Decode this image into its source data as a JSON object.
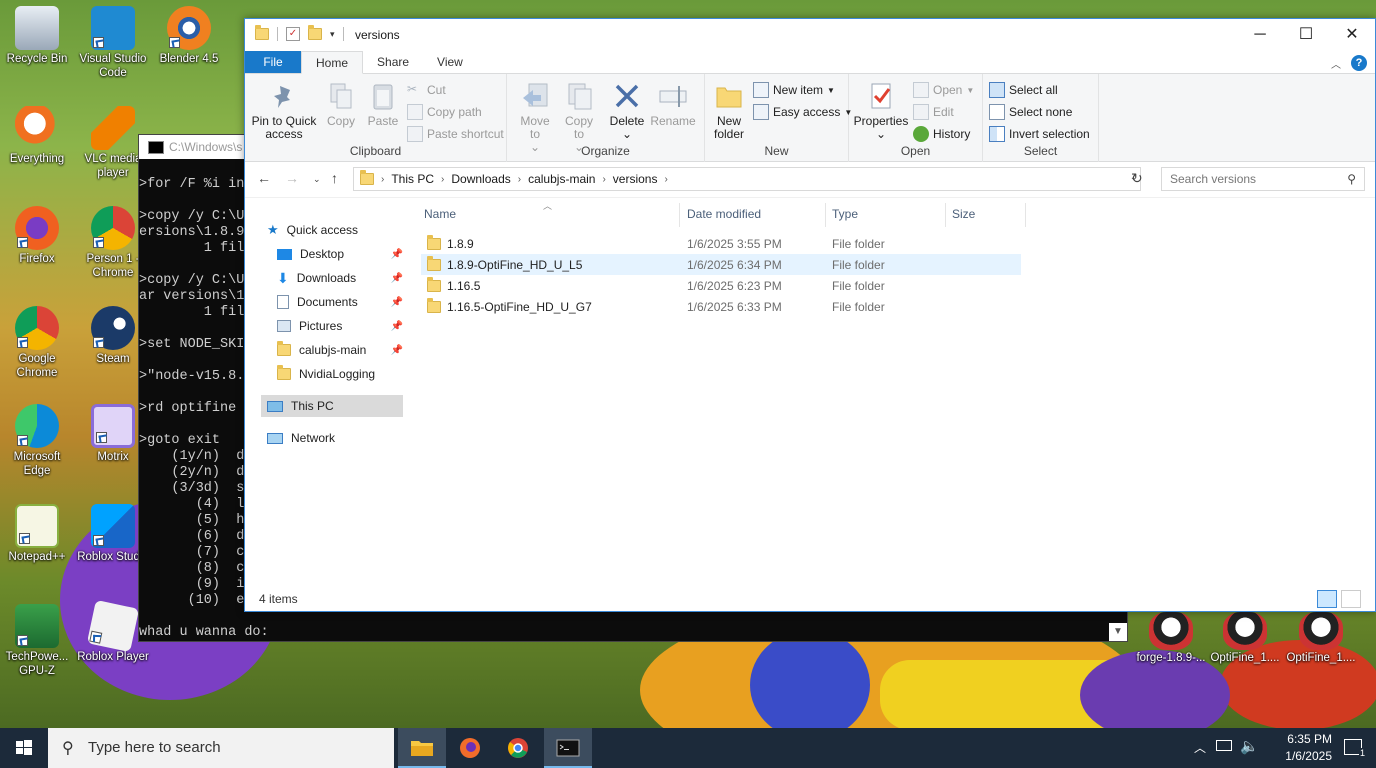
{
  "desktop": {
    "icons_left": [
      {
        "label": "Recycle Bin",
        "name": "recycle-bin-icon"
      },
      {
        "label": "Visual Studio Code",
        "name": "vscode-icon"
      },
      {
        "label": "Blender 4.5",
        "name": "blender-icon"
      },
      {
        "label": "Everything",
        "name": "everything-icon"
      },
      {
        "label": "VLC media player",
        "name": "vlc-icon"
      },
      {
        "label": "Firefox",
        "name": "firefox-icon"
      },
      {
        "label": "Person 1 - Chrome",
        "name": "chrome-person-icon"
      },
      {
        "label": "Google Chrome",
        "name": "chrome-icon"
      },
      {
        "label": "Steam",
        "name": "steam-icon"
      },
      {
        "label": "Microsoft Edge",
        "name": "edge-icon"
      },
      {
        "label": "Motrix",
        "name": "motrix-icon"
      },
      {
        "label": "Notepad++",
        "name": "notepadpp-icon"
      },
      {
        "label": "Roblox Studio",
        "name": "roblox-studio-icon"
      },
      {
        "label": "TechPowe... GPU-Z",
        "name": "gpuz-icon"
      },
      {
        "label": "Roblox Player",
        "name": "roblox-player-icon"
      }
    ],
    "icons_right": [
      {
        "label": "forge-1.8.9-...",
        "name": "java-jar-icon"
      },
      {
        "label": "OptiFine_1....",
        "name": "java-jar-icon"
      },
      {
        "label": "OptiFine_1....",
        "name": "java-jar-icon"
      }
    ]
  },
  "console": {
    "title": "C:\\Windows\\s",
    "lines": [
      "",
      ">for /F %i in",
      "",
      ">copy /y C:\\U",
      "ersions\\1.8.9",
      "        1 fil",
      "",
      ">copy /y C:\\U",
      "ar versions\\1",
      "        1 fil",
      "",
      ">set NODE_SKI",
      "",
      ">\"node-v15.8.",
      "",
      ">rd optifine",
      "",
      ">goto exit",
      "    (1y/n)  d",
      "    (2y/n)  d",
      "    (3/3d)  s",
      "       (4)  l",
      "       (5)  h",
      "       (6)  d",
      "       (7)  c",
      "       (8)  c",
      "       (9)  i",
      "      (10)  e",
      "",
      "whad u wanna do:"
    ]
  },
  "explorer": {
    "title": "versions",
    "window_buttons": {
      "minimize": "─",
      "maximize": "☐",
      "close": "✕"
    },
    "tabs": {
      "file": "File",
      "home": "Home",
      "share": "Share",
      "view": "View"
    },
    "ribbon": {
      "clipboard": {
        "group": "Clipboard",
        "pin": "Pin to Quick access",
        "copy": "Copy",
        "paste": "Paste",
        "cut": "Cut",
        "copy_path": "Copy path",
        "paste_shortcut": "Paste shortcut"
      },
      "organize": {
        "group": "Organize",
        "move_to": "Move to",
        "copy_to": "Copy to",
        "delete": "Delete",
        "rename": "Rename"
      },
      "new": {
        "group": "New",
        "new_folder": "New folder",
        "new_item": "New item",
        "easy_access": "Easy access"
      },
      "open": {
        "group": "Open",
        "properties": "Properties",
        "open": "Open",
        "edit": "Edit",
        "history": "History"
      },
      "select": {
        "group": "Select",
        "select_all": "Select all",
        "select_none": "Select none",
        "invert": "Invert selection"
      }
    },
    "address": {
      "crumbs": [
        "This PC",
        "Downloads",
        "calubjs-main",
        "versions"
      ],
      "search_placeholder": "Search versions"
    },
    "nav": {
      "quick_access": "Quick access",
      "pinned": [
        "Desktop",
        "Downloads",
        "Documents",
        "Pictures",
        "calubjs-main"
      ],
      "recent": [
        "NvidiaLogging"
      ],
      "this_pc": "This PC",
      "network": "Network"
    },
    "columns": {
      "name": "Name",
      "date": "Date modified",
      "type": "Type",
      "size": "Size"
    },
    "files": [
      {
        "name": "1.8.9",
        "date": "1/6/2025 3:55 PM",
        "type": "File folder"
      },
      {
        "name": "1.8.9-OptiFine_HD_U_L5",
        "date": "1/6/2025 6:34 PM",
        "type": "File folder"
      },
      {
        "name": "1.16.5",
        "date": "1/6/2025 6:23 PM",
        "type": "File folder"
      },
      {
        "name": "1.16.5-OptiFine_HD_U_G7",
        "date": "1/6/2025 6:33 PM",
        "type": "File folder"
      }
    ],
    "status": "4 items"
  },
  "taskbar": {
    "search_placeholder": "Type here to search",
    "time": "6:35 PM",
    "date": "1/6/2025",
    "notifications": "1"
  },
  "colors": {
    "accent": "#1979ca",
    "taskbar": "#1c2a3a",
    "highlight": "#e5f3ff"
  }
}
